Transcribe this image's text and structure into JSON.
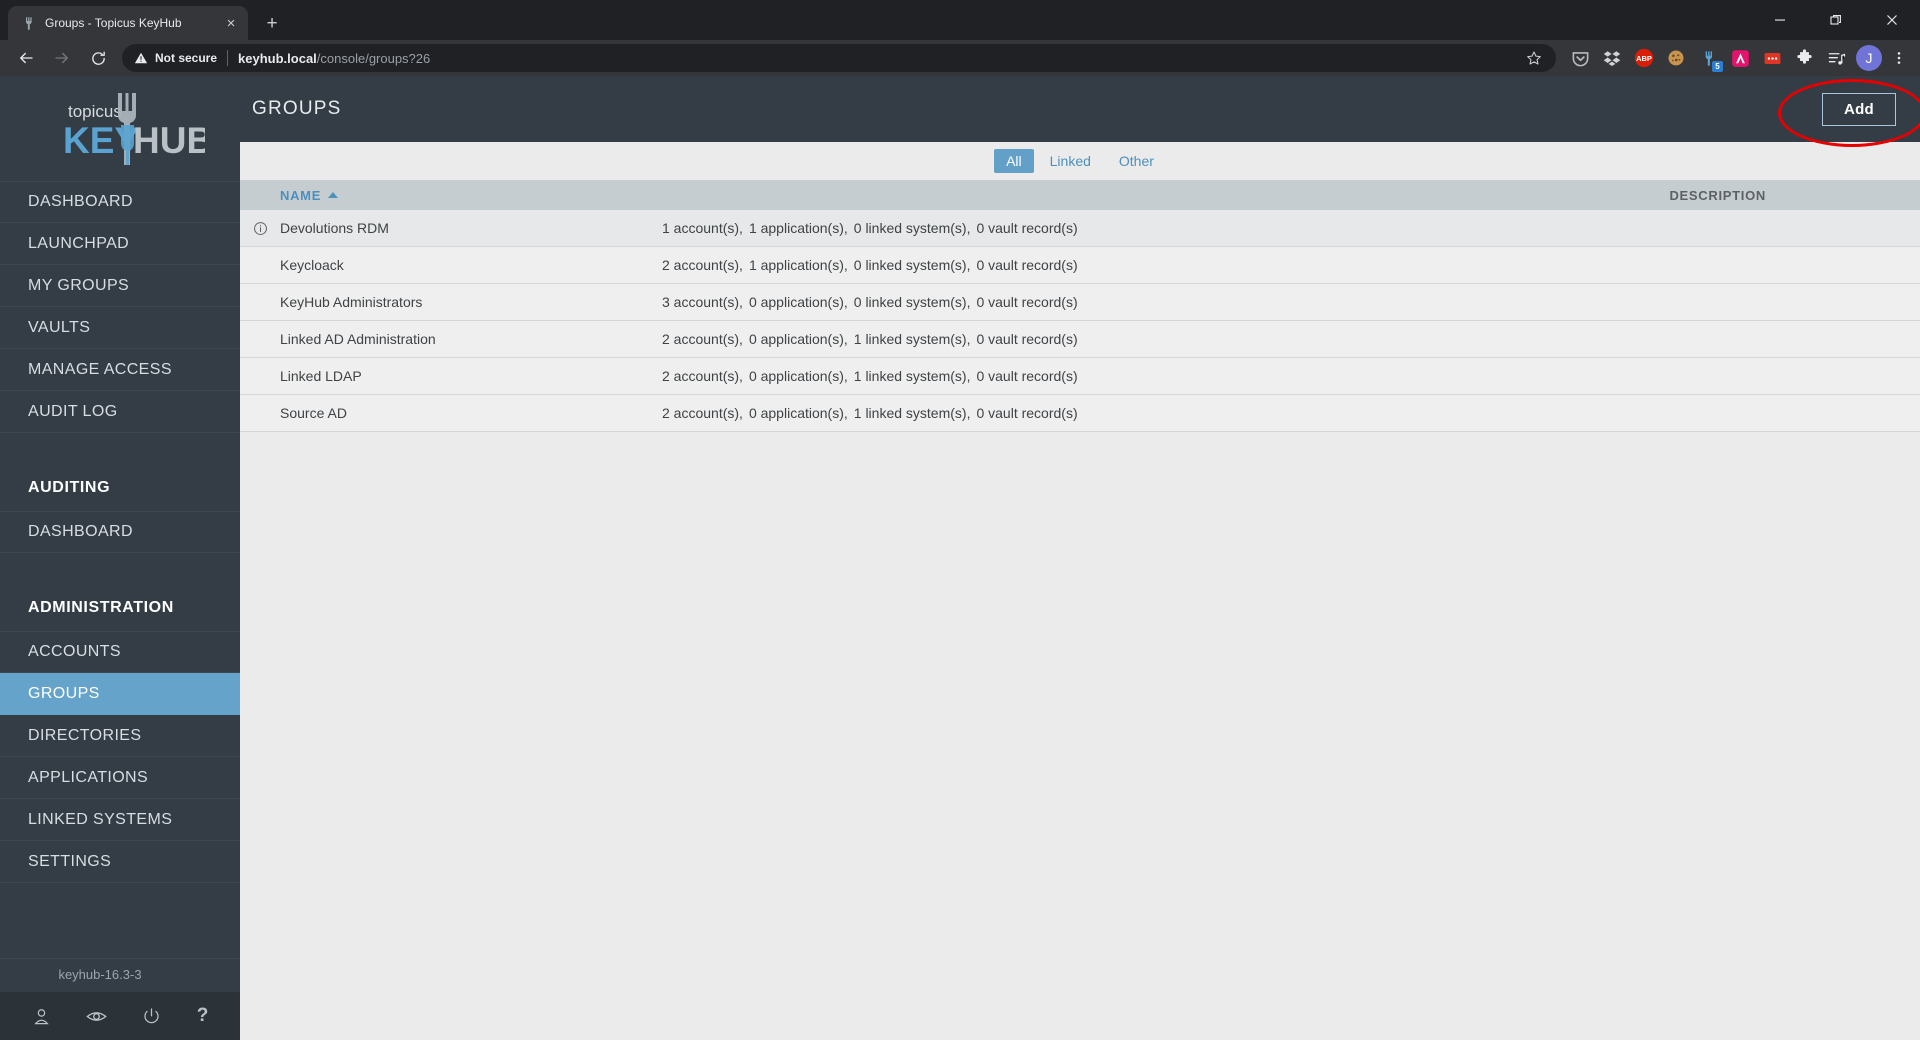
{
  "browser": {
    "tab": {
      "title": "Groups - Topicus KeyHub",
      "favicon": "keyhub-fork-icon",
      "close": "×"
    },
    "newtab_label": "+",
    "window_controls": {
      "minimize": "minimize-icon",
      "restore": "restore-icon",
      "close": "close-icon"
    },
    "nav": {
      "back": "back-arrow-icon",
      "forward": "forward-arrow-icon",
      "reload": "reload-icon"
    },
    "omnibox": {
      "security_label": "Not secure",
      "security_icon": "warning-triangle-icon",
      "url_host": "keyhub.local",
      "url_path": "/console/groups?26",
      "star_icon": "bookmark-star-icon"
    },
    "extensions": [
      {
        "name": "pocket-icon",
        "label": ""
      },
      {
        "name": "dropbox-icon",
        "label": ""
      },
      {
        "name": "adblock-plus-icon",
        "label": "ABP"
      },
      {
        "name": "cookie-icon",
        "label": ""
      },
      {
        "name": "keyhub-extension-icon",
        "label": "",
        "badge": "5"
      },
      {
        "name": "avast-icon",
        "label": "A"
      },
      {
        "name": "red-dots-icon",
        "label": ""
      },
      {
        "name": "puzzle-extensions-icon",
        "label": ""
      },
      {
        "name": "reading-list-icon",
        "label": ""
      }
    ],
    "profile_initial": "J",
    "menu_icon": "kebab-menu-icon"
  },
  "sidebar": {
    "logo": {
      "top": "topicus",
      "key": "KEY",
      "hub": "HUB"
    },
    "items": [
      {
        "label": "DASHBOARD",
        "active": false
      },
      {
        "label": "LAUNCHPAD",
        "active": false
      },
      {
        "label": "MY GROUPS",
        "active": false
      },
      {
        "label": "VAULTS",
        "active": false
      },
      {
        "label": "MANAGE ACCESS",
        "active": false
      },
      {
        "label": "AUDIT LOG",
        "active": false
      }
    ],
    "auditing": {
      "title": "AUDITING",
      "items": [
        {
          "label": "DASHBOARD",
          "active": false
        }
      ]
    },
    "administration": {
      "title": "ADMINISTRATION",
      "items": [
        {
          "label": "ACCOUNTS",
          "active": false
        },
        {
          "label": "GROUPS",
          "active": true
        },
        {
          "label": "DIRECTORIES",
          "active": false
        },
        {
          "label": "APPLICATIONS",
          "active": false
        },
        {
          "label": "LINKED SYSTEMS",
          "active": false
        },
        {
          "label": "SETTINGS",
          "active": false
        }
      ]
    },
    "version": "keyhub-16.3-3",
    "footer_icons": [
      {
        "name": "user-icon"
      },
      {
        "name": "eye-icon"
      },
      {
        "name": "power-icon"
      },
      {
        "name": "help-icon",
        "glyph": "?"
      }
    ]
  },
  "page": {
    "title": "GROUPS",
    "add_label": "Add",
    "filter_tabs": [
      {
        "label": "All",
        "active": true
      },
      {
        "label": "Linked",
        "active": false
      },
      {
        "label": "Other",
        "active": false
      }
    ]
  },
  "table": {
    "columns": {
      "name": "NAME",
      "description": "DESCRIPTION"
    },
    "sort": {
      "column": "NAME",
      "direction": "asc"
    },
    "rows": [
      {
        "name": "Devolutions RDM",
        "icon": "info-icon",
        "highlight": true,
        "stats": [
          "1 account(s),",
          "1 application(s),",
          "0 linked system(s),",
          "0 vault record(s)"
        ],
        "description": ""
      },
      {
        "name": "Keycloack",
        "icon": "",
        "highlight": false,
        "stats": [
          "2 account(s),",
          "1 application(s),",
          "0 linked system(s),",
          "0 vault record(s)"
        ],
        "description": ""
      },
      {
        "name": "KeyHub Administrators",
        "icon": "",
        "highlight": false,
        "stats": [
          "3 account(s),",
          "0 application(s),",
          "0 linked system(s),",
          "0 vault record(s)"
        ],
        "description": ""
      },
      {
        "name": "Linked AD Administration",
        "icon": "",
        "highlight": false,
        "stats": [
          "2 account(s),",
          "0 application(s),",
          "1 linked system(s),",
          "0 vault record(s)"
        ],
        "description": ""
      },
      {
        "name": "Linked LDAP",
        "icon": "",
        "highlight": false,
        "stats": [
          "2 account(s),",
          "0 application(s),",
          "1 linked system(s),",
          "0 vault record(s)"
        ],
        "description": ""
      },
      {
        "name": "Source AD",
        "icon": "",
        "highlight": false,
        "stats": [
          "2 account(s),",
          "0 application(s),",
          "1 linked system(s),",
          "0 vault record(s)"
        ],
        "description": ""
      }
    ]
  },
  "colors": {
    "sidebar_bg": "#343d46",
    "accent_blue": "#63a0c8",
    "link_blue": "#4d90bd",
    "annotation_red": "#e60000",
    "content_bg": "#ebebeb"
  }
}
